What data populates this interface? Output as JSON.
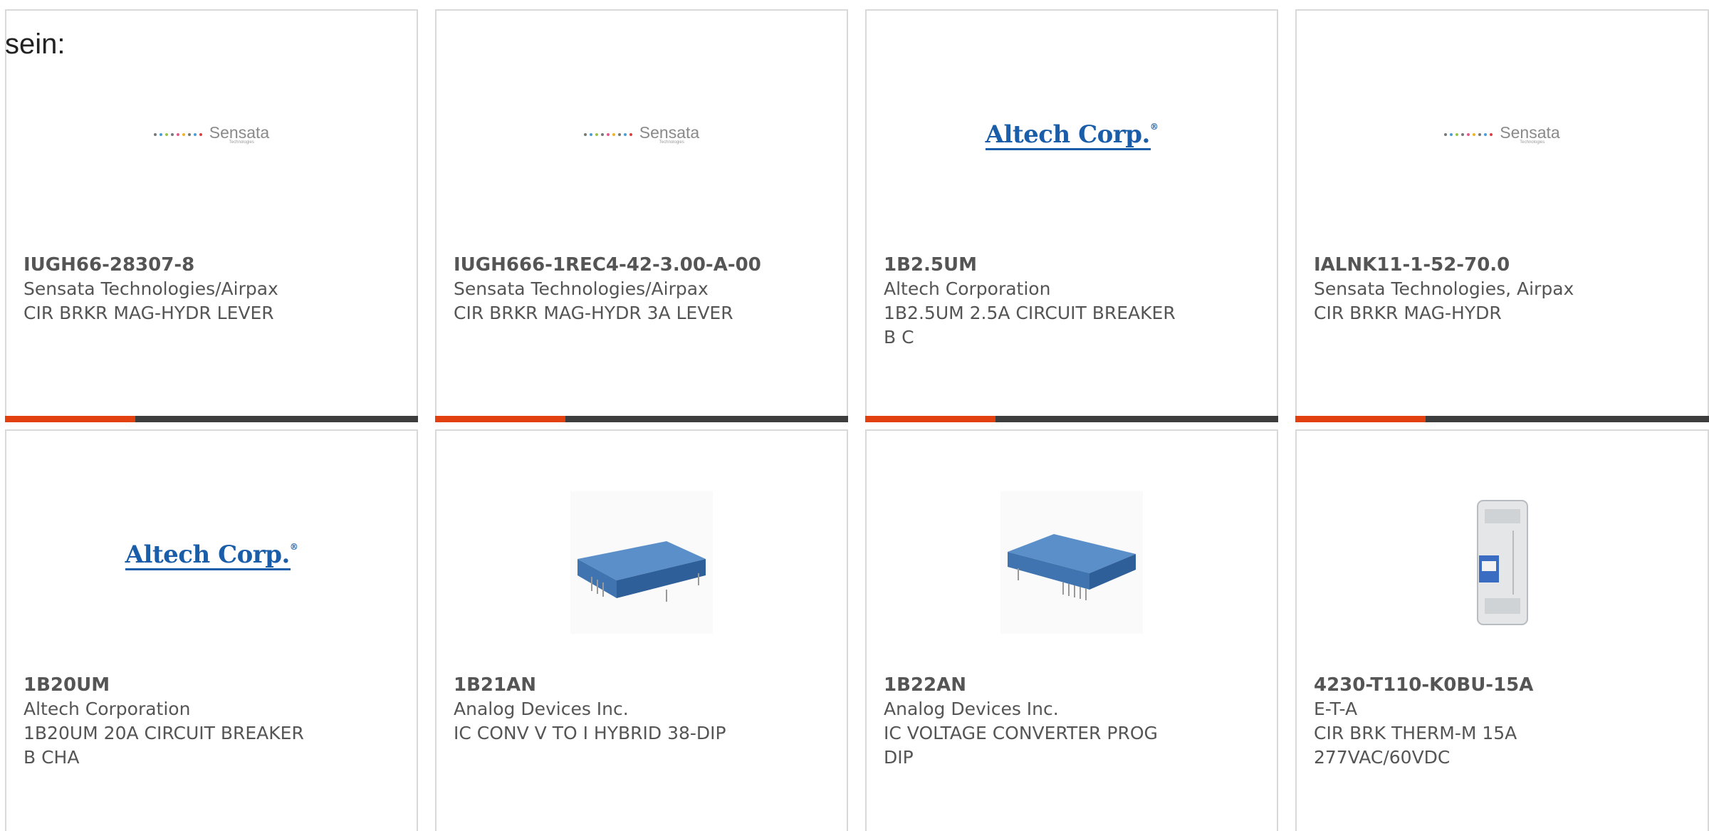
{
  "intro": {
    "text": "sein:"
  },
  "colors": {
    "accent": "#e2400f",
    "bar": "#3d3d3d",
    "card_border": "#d9d9d9",
    "text": "#555555",
    "altech_blue": "#1a5da8"
  },
  "products": [
    {
      "part_number": "IUGH66-28307-8",
      "manufacturer": "Sensata Technologies/Airpax",
      "description_lines": [
        "CIR BRKR MAG-HYDR LEVER"
      ],
      "image": {
        "type": "logo",
        "brand": "Sensata",
        "tagline": "Technologies"
      }
    },
    {
      "part_number": "IUGH666-1REC4-42-3.00-A-00",
      "manufacturer": "Sensata Technologies/Airpax",
      "description_lines": [
        "CIR BRKR MAG-HYDR 3A LEVER"
      ],
      "image": {
        "type": "logo",
        "brand": "Sensata",
        "tagline": "Technologies"
      }
    },
    {
      "part_number": "1B2.5UM",
      "manufacturer": "Altech Corporation",
      "description_lines": [
        "1B2.5UM 2.5A CIRCUIT BREAKER",
        "B C"
      ],
      "image": {
        "type": "logo",
        "brand": "Altech Corp.",
        "mark": "®"
      }
    },
    {
      "part_number": "IALNK11-1-52-70.0",
      "manufacturer": "Sensata Technologies, Airpax",
      "description_lines": [
        "CIR BRKR MAG-HYDR"
      ],
      "image": {
        "type": "logo",
        "brand": "Sensata",
        "tagline": "Technologies"
      }
    },
    {
      "part_number": "1B20UM",
      "manufacturer": "Altech Corporation",
      "description_lines": [
        "1B20UM 20A CIRCUIT BREAKER",
        "B CHA"
      ],
      "image": {
        "type": "logo",
        "brand": "Altech Corp.",
        "mark": "®"
      }
    },
    {
      "part_number": "1B21AN",
      "manufacturer": "Analog Devices Inc.",
      "description_lines": [
        "IC CONV V TO I HYBRID 38-DIP"
      ],
      "image": {
        "type": "photo",
        "subject": "blue-hybrid-module"
      }
    },
    {
      "part_number": "1B22AN",
      "manufacturer": "Analog Devices Inc.",
      "description_lines": [
        "IC VOLTAGE CONVERTER PROG",
        "DIP"
      ],
      "image": {
        "type": "photo",
        "subject": "blue-hybrid-module"
      }
    },
    {
      "part_number": "4230-T110-K0BU-15A",
      "manufacturer": "E-T-A",
      "description_lines": [
        "CIR BRK THERM-M 15A",
        "277VAC/60VDC"
      ],
      "image": {
        "type": "photo",
        "subject": "din-rail-breaker"
      }
    }
  ]
}
